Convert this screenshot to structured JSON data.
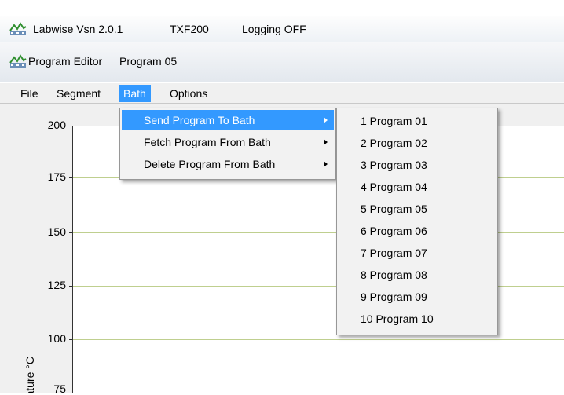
{
  "outer_title": {
    "app": "Labwise Vsn 2.0.1",
    "device": "TXF200",
    "logging": "Logging OFF"
  },
  "inner_title": {
    "editor": "Program Editor",
    "program": "Program 05"
  },
  "menubar": [
    "File",
    "Segment",
    "Bath",
    "Options"
  ],
  "bath_menu": [
    "Send Program To Bath",
    "Fetch Program From Bath",
    "Delete Program From Bath"
  ],
  "send_submenu": [
    "1 Program 01",
    "2 Program 02",
    "3 Program 03",
    "4 Program 04",
    "5 Program 05",
    "6 Program 06",
    "7 Program 07",
    "8 Program 08",
    "9 Program 09",
    "10  Program 10"
  ],
  "chart_data": {
    "type": "line",
    "ylabel": "erature °C",
    "y_ticks": [
      "200",
      "175",
      "150",
      "125",
      "100",
      "75"
    ]
  },
  "colors": {
    "highlight": "#3399ff",
    "grid": "#bfcf8f"
  }
}
